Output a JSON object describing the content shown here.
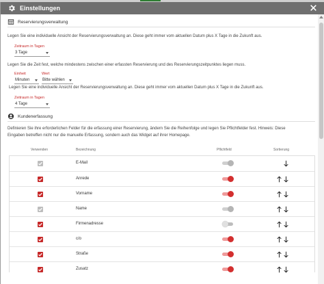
{
  "dialog": {
    "title": "Einstellungen"
  },
  "reservation": {
    "heading": "Reservierungsverwaltung",
    "desc1": "Legen Sie eine individuelle Ansicht der Reservierungsverwaltung an. Diese geht immer vom aktuellen Datum plus X Tage in die Zukunft aus.",
    "range1_label": "Zeitraum in Tagen",
    "range1_value": "3 Tage",
    "desc2": "Legen Sie die Zeit fest, welche mindestens zwischen einer erfassten Reservierung und des Reservierungszeitpunktes liegen muss.",
    "unit_label": "Einheit",
    "unit_value": "Minuten",
    "value_label": "Wert",
    "value_value": "Bitte wählen",
    "desc3": "Legen Sie eine individuelle Ansicht der Reservierungsverwaltung an. Diese geht immer vom aktuellen Datum plus X Tage in die Zukunft aus.",
    "range2_label": "Zeitraum in Tagen",
    "range2_value": "4 Tage"
  },
  "customer": {
    "heading": "Kundenerfassung",
    "desc_line1": "Definieren Sie ihre erforderlichen Felder für die erfassung einer Reservierung, ändern Sie die Reihenfolge und legen Sie Pflichtfelder fest. Hinweis: Diese",
    "desc_line2": "Eingaben betreffen nicht nur die manuelle Erfassung, sondern auch das Widget auf ihrer Homepage."
  },
  "table": {
    "columns": [
      "Verwenden",
      "Bezeichnung",
      "Pflichtfeld",
      "Sortierung"
    ],
    "rows": [
      {
        "name": "E-Mail",
        "use": "disabled",
        "required": "disabled",
        "sort": "down"
      },
      {
        "name": "Anrede",
        "use": "checked",
        "required": "on",
        "sort": "both"
      },
      {
        "name": "Vorname",
        "use": "checked",
        "required": "on",
        "sort": "both"
      },
      {
        "name": "Name",
        "use": "disabled",
        "required": "disabled",
        "sort": "both"
      },
      {
        "name": "Firmenadresse",
        "use": "checked",
        "required": "off",
        "sort": "both"
      },
      {
        "name": "c/o",
        "use": "checked",
        "required": "on",
        "sort": "both"
      },
      {
        "name": "Straße",
        "use": "checked",
        "required": "on",
        "sort": "both"
      },
      {
        "name": "Zusatz",
        "use": "checked",
        "required": "on",
        "sort": "both"
      }
    ]
  },
  "colors": {
    "accent": "#c62828",
    "titlebar": "#6f6f6f",
    "disabled": "#bdbdbd"
  },
  "icons": {
    "title": "gear-icon",
    "close": "close-icon",
    "section1": "calendar-table-icon",
    "section2": "account-circle-icon"
  }
}
